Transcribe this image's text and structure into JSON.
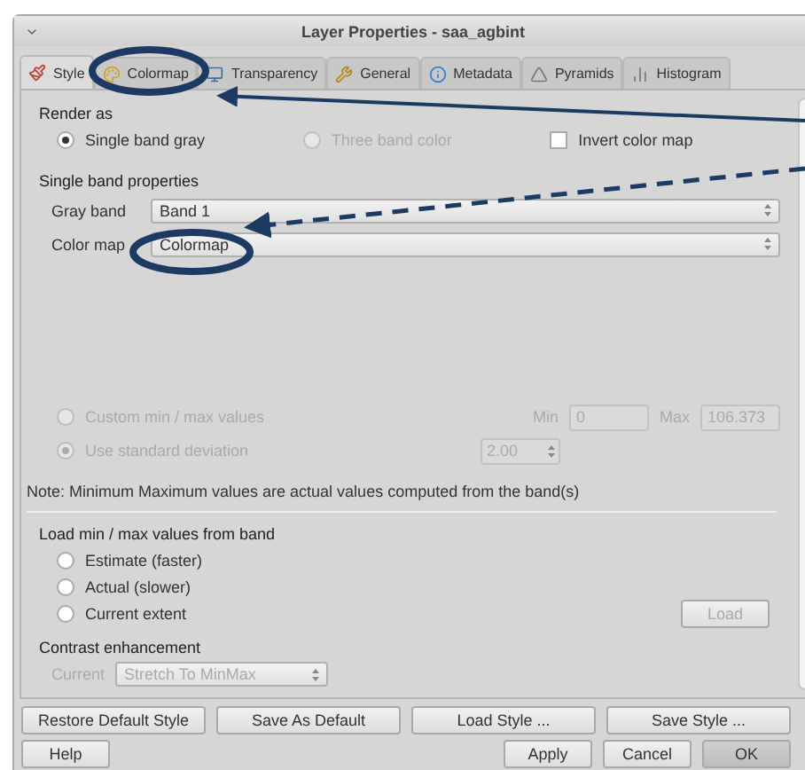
{
  "window": {
    "title": "Layer Properties - saa_agbint"
  },
  "tabs": [
    {
      "label": "Style",
      "selected": true
    },
    {
      "label": "Colormap",
      "selected": false
    },
    {
      "label": "Transparency",
      "selected": false
    },
    {
      "label": "General",
      "selected": false
    },
    {
      "label": "Metadata",
      "selected": false
    },
    {
      "label": "Pyramids",
      "selected": false
    },
    {
      "label": "Histogram",
      "selected": false
    }
  ],
  "render_as": {
    "heading": "Render as",
    "options": [
      {
        "label": "Single band gray",
        "selected": true,
        "disabled": false
      },
      {
        "label": "Three band color",
        "selected": false,
        "disabled": true
      }
    ],
    "invert": {
      "label": "Invert color map",
      "checked": false
    }
  },
  "single_band": {
    "heading": "Single band properties",
    "fields": [
      {
        "label": "Gray band",
        "value": "Band 1"
      },
      {
        "label": "Color map",
        "value": "Colormap"
      }
    ]
  },
  "minmax": {
    "options": [
      {
        "label": "Custom min / max values",
        "selected": false,
        "disabled": true
      },
      {
        "label": "Use standard deviation",
        "selected": true,
        "disabled": true
      }
    ],
    "min_label": "Min",
    "min_value": "0",
    "max_label": "Max",
    "max_value": "106.373",
    "std_value": "2.00",
    "note": "Note: Minimum Maximum values are actual values computed from the band(s)"
  },
  "load": {
    "heading": "Load min / max values from band",
    "options": [
      {
        "label": "Estimate (faster)",
        "selected": false
      },
      {
        "label": "Actual (slower)",
        "selected": false
      },
      {
        "label": "Current extent",
        "selected": false
      }
    ],
    "button": {
      "label": "Load",
      "disabled": true
    }
  },
  "contrast": {
    "heading": "Contrast enhancement",
    "label": "Current",
    "value": "Stretch To MinMax",
    "disabled": true
  },
  "style_buttons": [
    "Restore Default Style",
    "Save As Default",
    "Load Style ...",
    "Save Style ..."
  ],
  "dialog_buttons": [
    {
      "label": "Help",
      "default": false
    },
    {
      "label": "Apply",
      "default": false
    },
    {
      "label": "Cancel",
      "default": false
    },
    {
      "label": "OK",
      "default": true
    }
  ]
}
